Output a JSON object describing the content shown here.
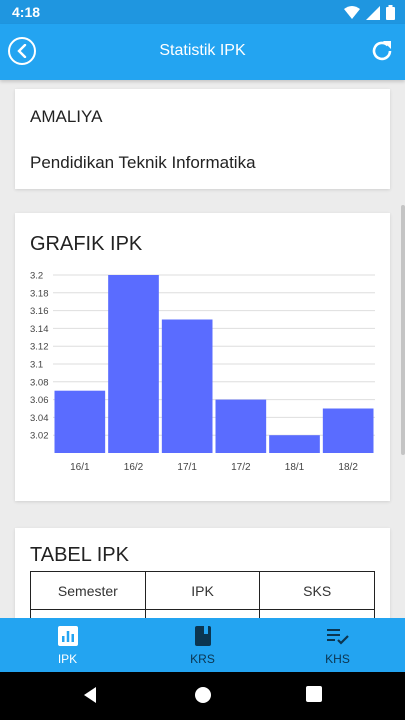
{
  "status_bar": {
    "time": "4:18",
    "icons": [
      "wifi-icon",
      "signal-icon",
      "battery-icon"
    ]
  },
  "app_bar": {
    "title": "Statistik IPK",
    "back_icon": "back-icon",
    "refresh_icon": "refresh-icon"
  },
  "profile": {
    "name": "AMALIYA",
    "program": "Pendidikan Teknik Informatika"
  },
  "chart_card": {
    "title": "GRAFIK IPK"
  },
  "chart_data": {
    "type": "bar",
    "categories": [
      "16/1",
      "16/2",
      "17/1",
      "17/2",
      "18/1",
      "18/2"
    ],
    "values": [
      3.07,
      3.2,
      3.15,
      3.06,
      3.02,
      3.05
    ],
    "ylim": [
      3.0,
      3.2
    ],
    "y_ticks": [
      "3.2",
      "3.18",
      "3.16",
      "3.14",
      "3.12",
      "3.1",
      "3.08",
      "3.06",
      "3.04",
      "3.02"
    ],
    "bar_color": "#5a6cff",
    "grid": true
  },
  "table_card": {
    "title": "TABEL IPK",
    "headers": [
      "Semester",
      "IPK",
      "SKS"
    ]
  },
  "bottom_nav": {
    "items": [
      {
        "label": "IPK",
        "icon": "bar-chart-icon",
        "active": true
      },
      {
        "label": "KRS",
        "icon": "book-icon",
        "active": false
      },
      {
        "label": "KHS",
        "icon": "checklist-icon",
        "active": false
      }
    ]
  },
  "colors": {
    "primary": "#23a4f1",
    "status_bar": "#1f96e0",
    "active_nav": "#ffffff",
    "inactive_nav": "#0b3550"
  }
}
